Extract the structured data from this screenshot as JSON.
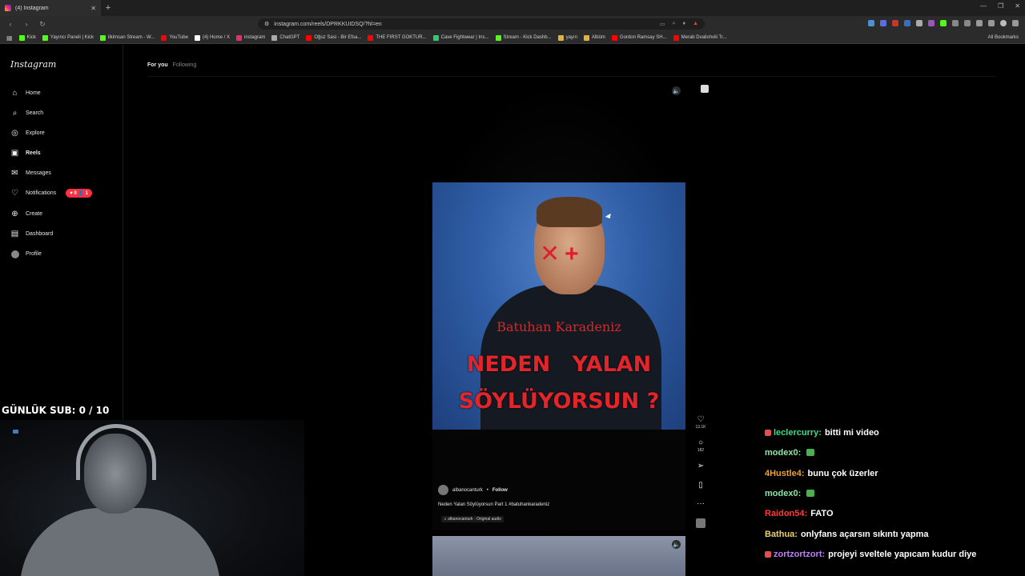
{
  "browser": {
    "tab_title": "(4) Instagram",
    "url": "instagram.com/reels/DPRKKUIDSQ/?hl=en",
    "bookmarks": [
      {
        "label": "Kick",
        "color": "#53fc18"
      },
      {
        "label": "Yayıncı Paneli | Kick",
        "color": "#53fc18"
      },
      {
        "label": "ilkimsan Stream - W...",
        "color": "#53fc18"
      },
      {
        "label": "YouTube",
        "color": "#ff0000"
      },
      {
        "label": "(4) Home / X",
        "color": "#ffffff"
      },
      {
        "label": "instagram",
        "color": "#e1306c"
      },
      {
        "label": "ChatGPT",
        "color": "#aaaaaa"
      },
      {
        "label": "Oğuz Sasi - Bir Efsa...",
        "color": "#ff0000"
      },
      {
        "label": "THE FIRST GOKTUR...",
        "color": "#ff0000"
      },
      {
        "label": "Cave Fightwear | Ins...",
        "color": "#2ecc71"
      },
      {
        "label": "Stream - Kick Dashb...",
        "color": "#53fc18"
      },
      {
        "label": "yayın",
        "color": "#e2b33c"
      },
      {
        "label": "Albüm",
        "color": "#e2b33c"
      },
      {
        "label": "Gordon Ramsay SH...",
        "color": "#ff0000"
      },
      {
        "label": "Merab Dvalishvili Tr...",
        "color": "#ff0000"
      }
    ],
    "all_bookmarks": "All Bookmarks"
  },
  "sidebar": {
    "logo": "Instagram",
    "items": [
      {
        "label": "Home",
        "icon": "home-icon"
      },
      {
        "label": "Search",
        "icon": "search-icon"
      },
      {
        "label": "Explore",
        "icon": "explore-icon"
      },
      {
        "label": "Reels",
        "icon": "reels-icon"
      },
      {
        "label": "Messages",
        "icon": "messages-icon"
      },
      {
        "label": "Notifications",
        "icon": "heart-icon"
      },
      {
        "label": "Create",
        "icon": "plus-icon"
      },
      {
        "label": "Dashboard",
        "icon": "dashboard-icon"
      },
      {
        "label": "Profile",
        "icon": "avatar"
      }
    ],
    "notif_pill": "♥ 9  👤 1"
  },
  "feed_tabs": {
    "for_you": "For you",
    "following": "Following"
  },
  "reel": {
    "overlay_name": "Batuhan Karadeniz",
    "overlay_line1": "NEDEN YALAN",
    "overlay_line2": "SÖYLÜYORSUN ?",
    "author": "albanocanturk",
    "dot": "•",
    "follow": "Follow",
    "caption": "Neden Yalan Söylüyorsun Part 1 #batuhankaradeniz",
    "audio": "♫ albanocanturk · Original audio",
    "likes": "13.1K",
    "comments": "182"
  },
  "stream": {
    "sub_goal": "GÜNLÜK SUB: 0 / 10",
    "chat": [
      {
        "user": "leclercurry:",
        "text": "bitti mi video",
        "color": "#3ddc84",
        "badge": "#e05050"
      },
      {
        "user": "modex0:",
        "text": "",
        "color": "#8ee6a8",
        "emote": true
      },
      {
        "user": "4Hustle4:",
        "text": "bunu çok üzerler",
        "color": "#f0a030"
      },
      {
        "user": "modex0:",
        "text": "",
        "color": "#8ee6a8",
        "emote": true
      },
      {
        "user": "Raidon54:",
        "text": "FATO",
        "color": "#ff3b3b"
      },
      {
        "user": "Bathua:",
        "text": "onlyfans açarsın sıkıntı yapma",
        "color": "#e8d070"
      },
      {
        "user": "zortzortzort:",
        "text": "projeyi sveltele yapıcam kudur diye",
        "color": "#c07cff",
        "badge": "#e05050"
      }
    ]
  }
}
